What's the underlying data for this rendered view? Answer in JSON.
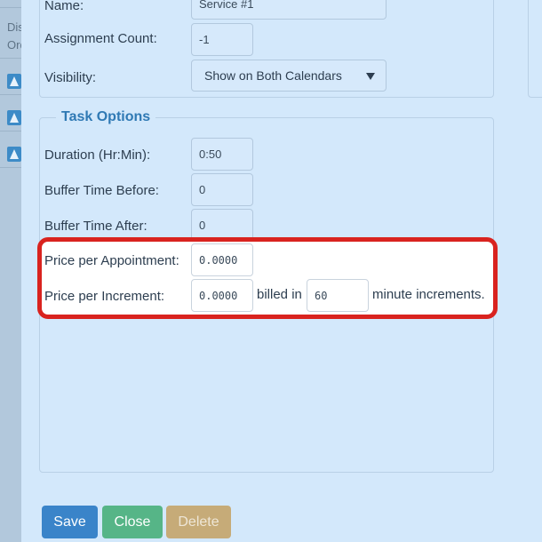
{
  "background_table": {
    "header": "Display Order",
    "header_line1": "Dis",
    "header_line2": "Ord",
    "rows": [
      {
        "action": "move-up"
      },
      {
        "action": "move-up"
      },
      {
        "action": "move-up"
      }
    ]
  },
  "general": {
    "name_label": "Name:",
    "name_value": "Service #1",
    "assignment_label": "Assignment Count:",
    "assignment_value": "-1",
    "visibility_label": "Visibility:",
    "visibility_value": "Show on Both Calendars"
  },
  "task_options": {
    "legend": "Task Options",
    "duration_label": "Duration (Hr:Min):",
    "duration_value": "0:50",
    "buffer_before_label": "Buffer Time Before:",
    "buffer_before_value": "0",
    "buffer_after_label": "Buffer Time After:",
    "buffer_after_value": "0",
    "price_appointment_label": "Price per Appointment:",
    "price_appointment_value": "0.0000",
    "price_increment_label": "Price per Increment:",
    "price_increment_value": "0.0000",
    "billed_in_text": "billed in",
    "increment_minutes_value": "60",
    "increment_suffix_text": "minute increments."
  },
  "highlight": {
    "color": "#d9231f"
  },
  "buttons": {
    "save": "Save",
    "close": "Close",
    "delete": "Delete"
  },
  "colors": {
    "save": "#3a84c9",
    "close": "#56b587",
    "delete": "#c6ab78",
    "legend": "#2f79b4",
    "background": "#d3e8fb"
  }
}
